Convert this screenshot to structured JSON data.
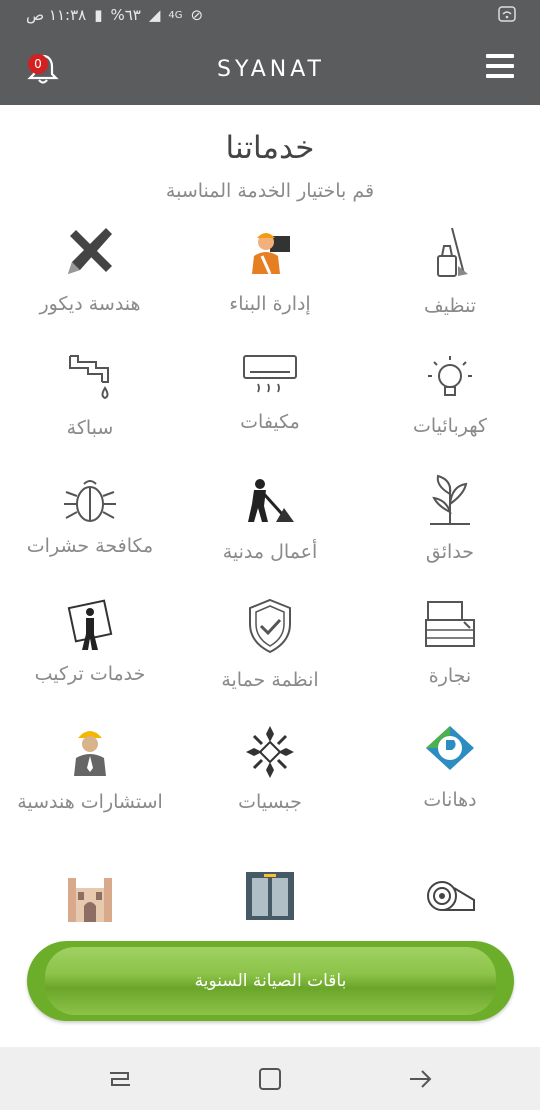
{
  "status_bar": {
    "time": "١١:٣٨ ص",
    "battery": "%٦٣",
    "network": "4G"
  },
  "app_bar": {
    "logo": "SYANAT",
    "notification_count": "0"
  },
  "header": {
    "title": "خدماتنا",
    "subtitle": "قم باختيار الخدمة المناسبة"
  },
  "services": [
    {
      "label": "تنظيف",
      "icon": "cleaning-icon"
    },
    {
      "label": "إدارة البناء",
      "icon": "construction-worker-icon"
    },
    {
      "label": "هندسة ديكور",
      "icon": "ruler-pencil-icon"
    },
    {
      "label": "كهربائيات",
      "icon": "light-bulb-icon"
    },
    {
      "label": "مكيفات",
      "icon": "air-conditioner-icon"
    },
    {
      "label": "سباكة",
      "icon": "faucet-icon"
    },
    {
      "label": "حدائق",
      "icon": "plant-icon"
    },
    {
      "label": "أعمال مدنية",
      "icon": "digging-worker-icon"
    },
    {
      "label": "مكافحة حشرات",
      "icon": "bug-icon"
    },
    {
      "label": "نجارة",
      "icon": "carpentry-icon"
    },
    {
      "label": "انظمة حماية",
      "icon": "shield-check-icon"
    },
    {
      "label": "خدمات تركيب",
      "icon": "installer-icon"
    },
    {
      "label": "دهانات",
      "icon": "paint-logo-icon"
    },
    {
      "label": "جبسيات",
      "icon": "gypsum-pattern-icon"
    },
    {
      "label": "استشارات هندسية",
      "icon": "engineer-icon"
    },
    {
      "label": "",
      "icon": "roll-icon"
    },
    {
      "label": "",
      "icon": "elevator-icon"
    },
    {
      "label": "",
      "icon": "building-icon"
    }
  ],
  "cta": {
    "label": "باقات الصيانة السنوية",
    "color": "#6cae2a"
  },
  "colors": {
    "app_bar": "#5b5c5e",
    "text_gray": "#8a8a8a",
    "badge": "#d32020"
  }
}
